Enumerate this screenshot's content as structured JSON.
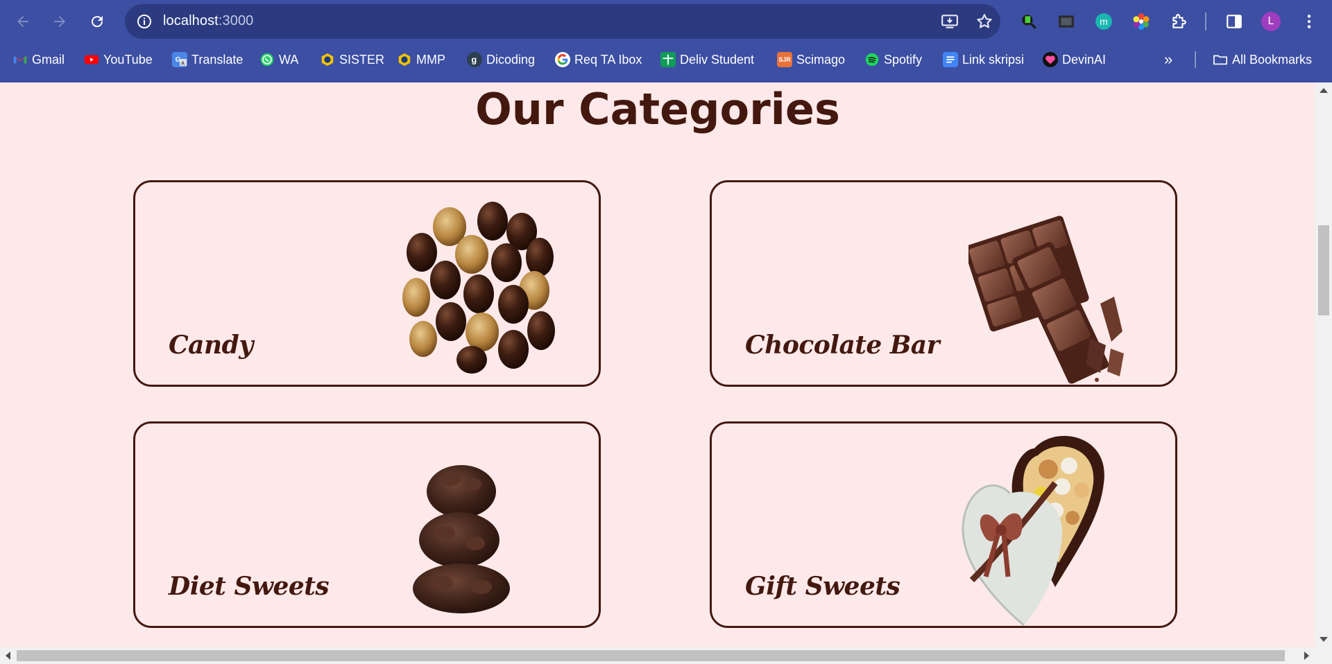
{
  "browser": {
    "url_host": "localhost",
    "url_port": ":3000",
    "profile_initial": "L",
    "colors": {
      "frame": "#3c4fa3",
      "omnibox": "#2c3b80",
      "avatar": "#a03dbf"
    },
    "toolbar_icons": [
      "back-icon",
      "forward-icon",
      "reload-icon",
      "info-icon",
      "install-app-icon",
      "star-icon",
      "extension-green-icon",
      "screen-capture-icon",
      "extension-m-icon",
      "color-picker-icon",
      "extensions-puzzle-icon",
      "side-panel-icon",
      "kebab-menu-icon"
    ],
    "bookmarks": [
      {
        "label": "Gmail",
        "icon": "gmail-icon"
      },
      {
        "label": "YouTube",
        "icon": "youtube-icon"
      },
      {
        "label": "Translate",
        "icon": "translate-icon"
      },
      {
        "label": "WA",
        "icon": "whatsapp-icon"
      },
      {
        "label": "SISTER",
        "icon": "sister-icon"
      },
      {
        "label": "MMP",
        "icon": "mmp-icon"
      },
      {
        "label": "Dicoding",
        "icon": "dicoding-icon"
      },
      {
        "label": "Req TA Ibox",
        "icon": "google-icon"
      },
      {
        "label": "Deliv Student",
        "icon": "sheets-icon"
      },
      {
        "label": "Scimago",
        "icon": "sjr-icon"
      },
      {
        "label": "Spotify",
        "icon": "spotify-icon"
      },
      {
        "label": "Link skripsi",
        "icon": "docs-icon"
      },
      {
        "label": "DevinAI",
        "icon": "heart-icon"
      }
    ],
    "all_bookmarks_label": "All Bookmarks",
    "sjr_icon_text": "SJR"
  },
  "page": {
    "heading": "Our Categories",
    "colors": {
      "background": "#fde9e9",
      "accent": "#43180f"
    },
    "categories": [
      {
        "label": "Candy",
        "image": "chocolate-truffles-image"
      },
      {
        "label": "Chocolate Bar",
        "image": "chocolate-bar-image"
      },
      {
        "label": "Diet Sweets",
        "image": "chocolate-clusters-image"
      },
      {
        "label": "Gift Sweets",
        "image": "heart-gift-box-image"
      }
    ]
  }
}
